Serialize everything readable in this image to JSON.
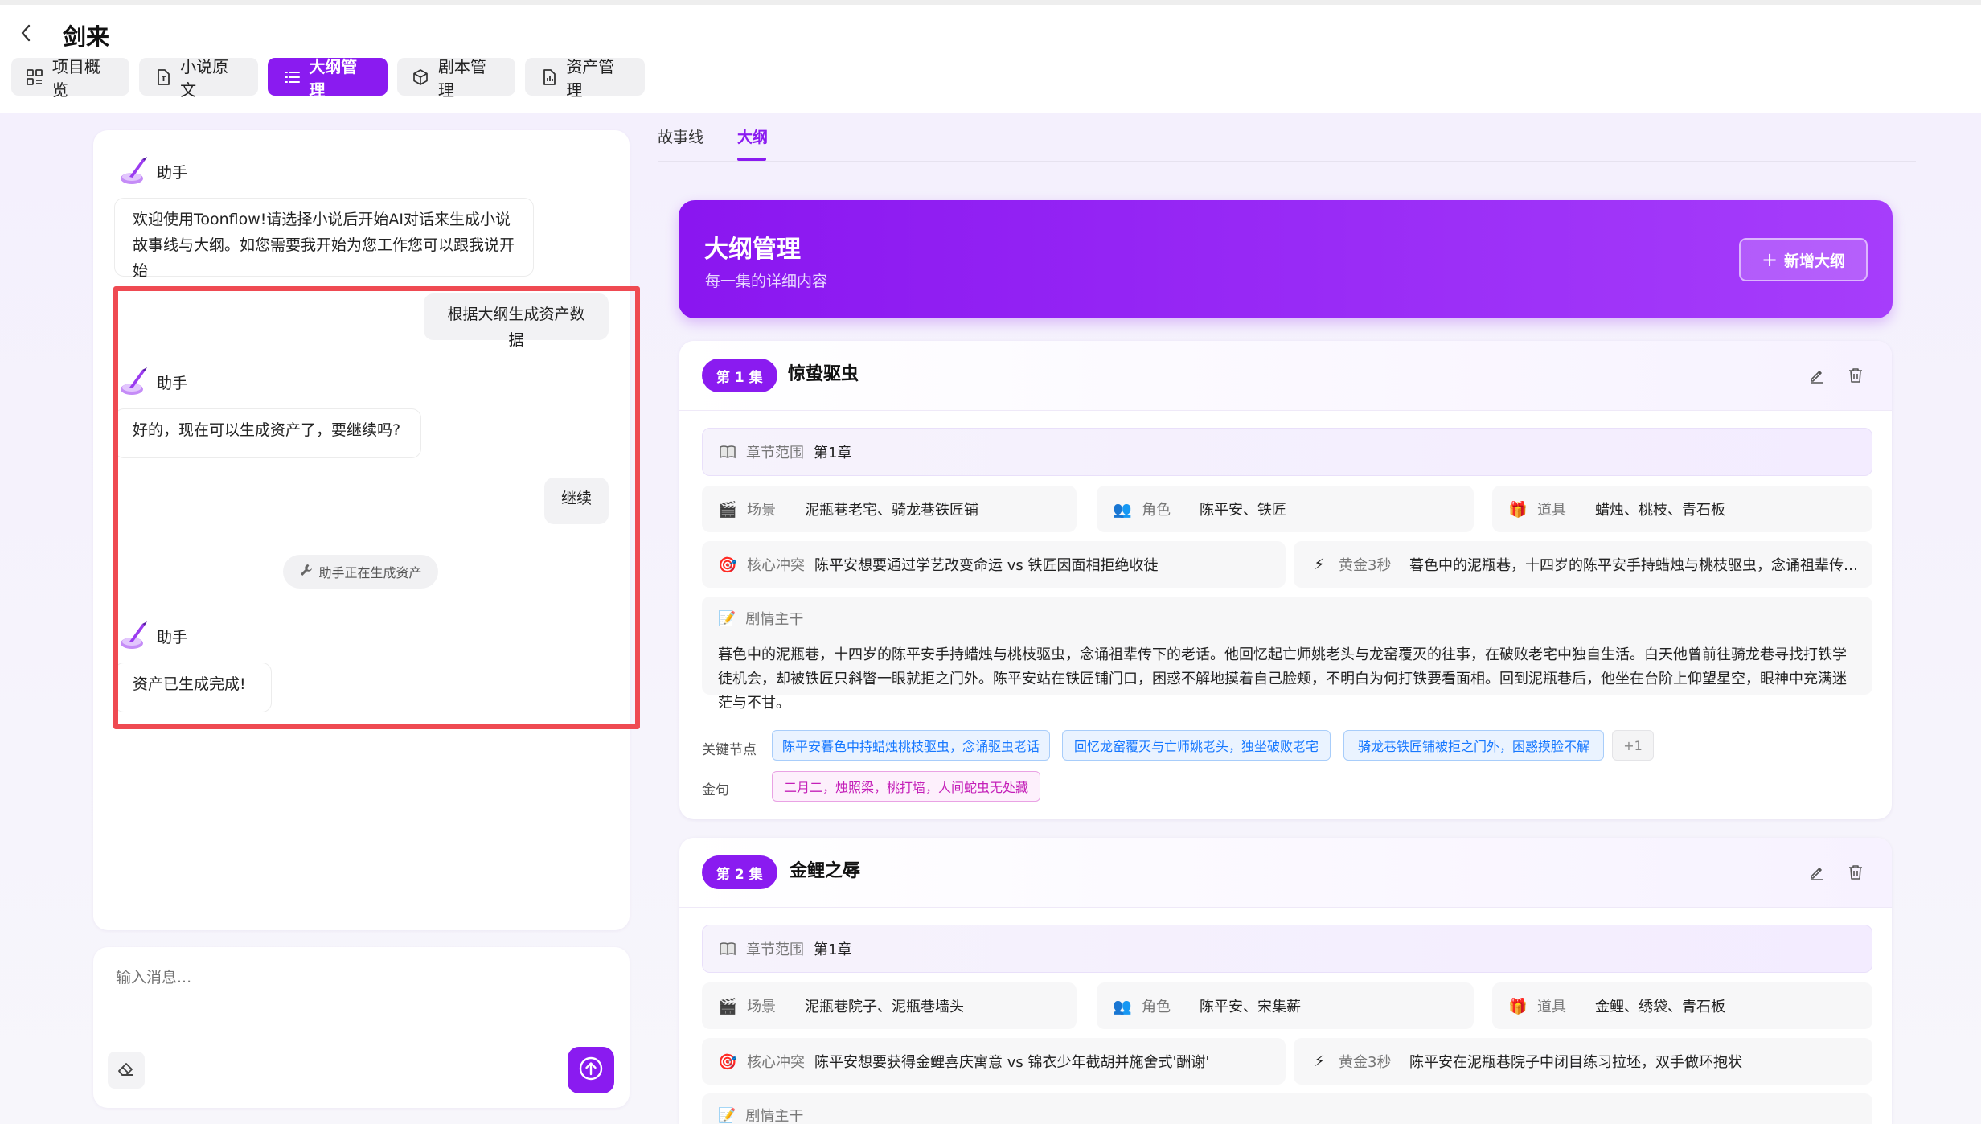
{
  "app": {
    "title": "剑来",
    "tabs": [
      {
        "label": "项目概览",
        "icon": "grid-icon",
        "active": false
      },
      {
        "label": "小说原文",
        "icon": "document-icon",
        "active": false
      },
      {
        "label": "大纲管理",
        "icon": "list-icon",
        "active": true
      },
      {
        "label": "剧本管理",
        "icon": "cube-icon",
        "active": false
      },
      {
        "label": "资产管理",
        "icon": "file-chart-icon",
        "active": false
      }
    ]
  },
  "chat": {
    "assistant_name": "助手",
    "messages": [
      {
        "role": "assistant",
        "text": "欢迎使用Toonflow!请选择小说后开始AI对话来生成小说故事线与大纲。如您需要我开始为您工作您可以跟我说开始"
      },
      {
        "role": "user",
        "text": "根据大纲生成资产数据"
      },
      {
        "role": "assistant",
        "text": "好的，现在可以生成资产了，要继续吗?"
      },
      {
        "role": "user",
        "text": "继续"
      },
      {
        "role": "status",
        "text": "助手正在生成资产"
      },
      {
        "role": "assistant",
        "text": "资产已生成完成!"
      }
    ],
    "input_placeholder": "输入消息..."
  },
  "outline": {
    "subtabs": [
      {
        "label": "故事线",
        "active": false
      },
      {
        "label": "大纲",
        "active": true
      }
    ],
    "banner": {
      "title": "大纲管理",
      "subtitle": "每一集的详细内容",
      "add_button": "新增大纲"
    },
    "labels": {
      "chapter_range": "章节范围",
      "scene": "场景",
      "character": "角色",
      "prop": "道具",
      "conflict": "核心冲突",
      "hook": "黄金3秒",
      "plot": "剧情主干",
      "key_nodes": "关键节点",
      "golden_line": "金句"
    },
    "episodes": [
      {
        "badge": "第 1 集",
        "title": "惊蛰驱虫",
        "chapter_range": "第1章",
        "scene": "泥瓶巷老宅、骑龙巷铁匠铺",
        "character": "陈平安、铁匠",
        "prop": "蜡烛、桃枝、青石板",
        "conflict": "陈平安想要通过学艺改变命运 vs 铁匠因面相拒绝收徒",
        "hook": "暮色中的泥瓶巷，十四岁的陈平安手持蜡烛与桃枝驱虫，念诵祖辈传下...",
        "plot": "暮色中的泥瓶巷，十四岁的陈平安手持蜡烛与桃枝驱虫，念诵祖辈传下的老话。他回忆起亡师姚老头与龙窑覆灭的往事，在破败老宅中独自生活。白天他曾前往骑龙巷寻找打铁学徒机会，却被铁匠只斜瞥一眼就拒之门外。陈平安站在铁匠铺门口，困惑不解地摸着自己脸颊，不明白为何打铁要看面相。回到泥瓶巷后，他坐在台阶上仰望星空，眼神中充满迷茫与不甘。",
        "key_nodes": [
          "陈平安暮色中持蜡烛桃枝驱虫，念诵驱虫老话",
          "回忆龙窑覆灭与亡师姚老头，独坐破败老宅",
          "骑龙巷铁匠铺被拒之门外，困惑摸脸不解"
        ],
        "key_nodes_more": "+1",
        "golden_lines": [
          "二月二，烛照梁，桃打墙，人间蛇虫无处藏"
        ]
      },
      {
        "badge": "第 2 集",
        "title": "金鲤之辱",
        "chapter_range": "第1章",
        "scene": "泥瓶巷院子、泥瓶巷墙头",
        "character": "陈平安、宋集薪",
        "prop": "金鲤、绣袋、青石板",
        "conflict": "陈平安想要获得金鲤喜庆寓意 vs 锦衣少年截胡并施舍式'酬谢'",
        "hook": "陈平安在泥瓶巷院子中闭目练习拉坯，双手做环抱状",
        "plot": ""
      }
    ]
  },
  "colors": {
    "accent": "#8a1bf0",
    "highlight_border": "#ef4a52",
    "chip_blue": "#1677ff",
    "chip_pink": "#c41fb8"
  }
}
